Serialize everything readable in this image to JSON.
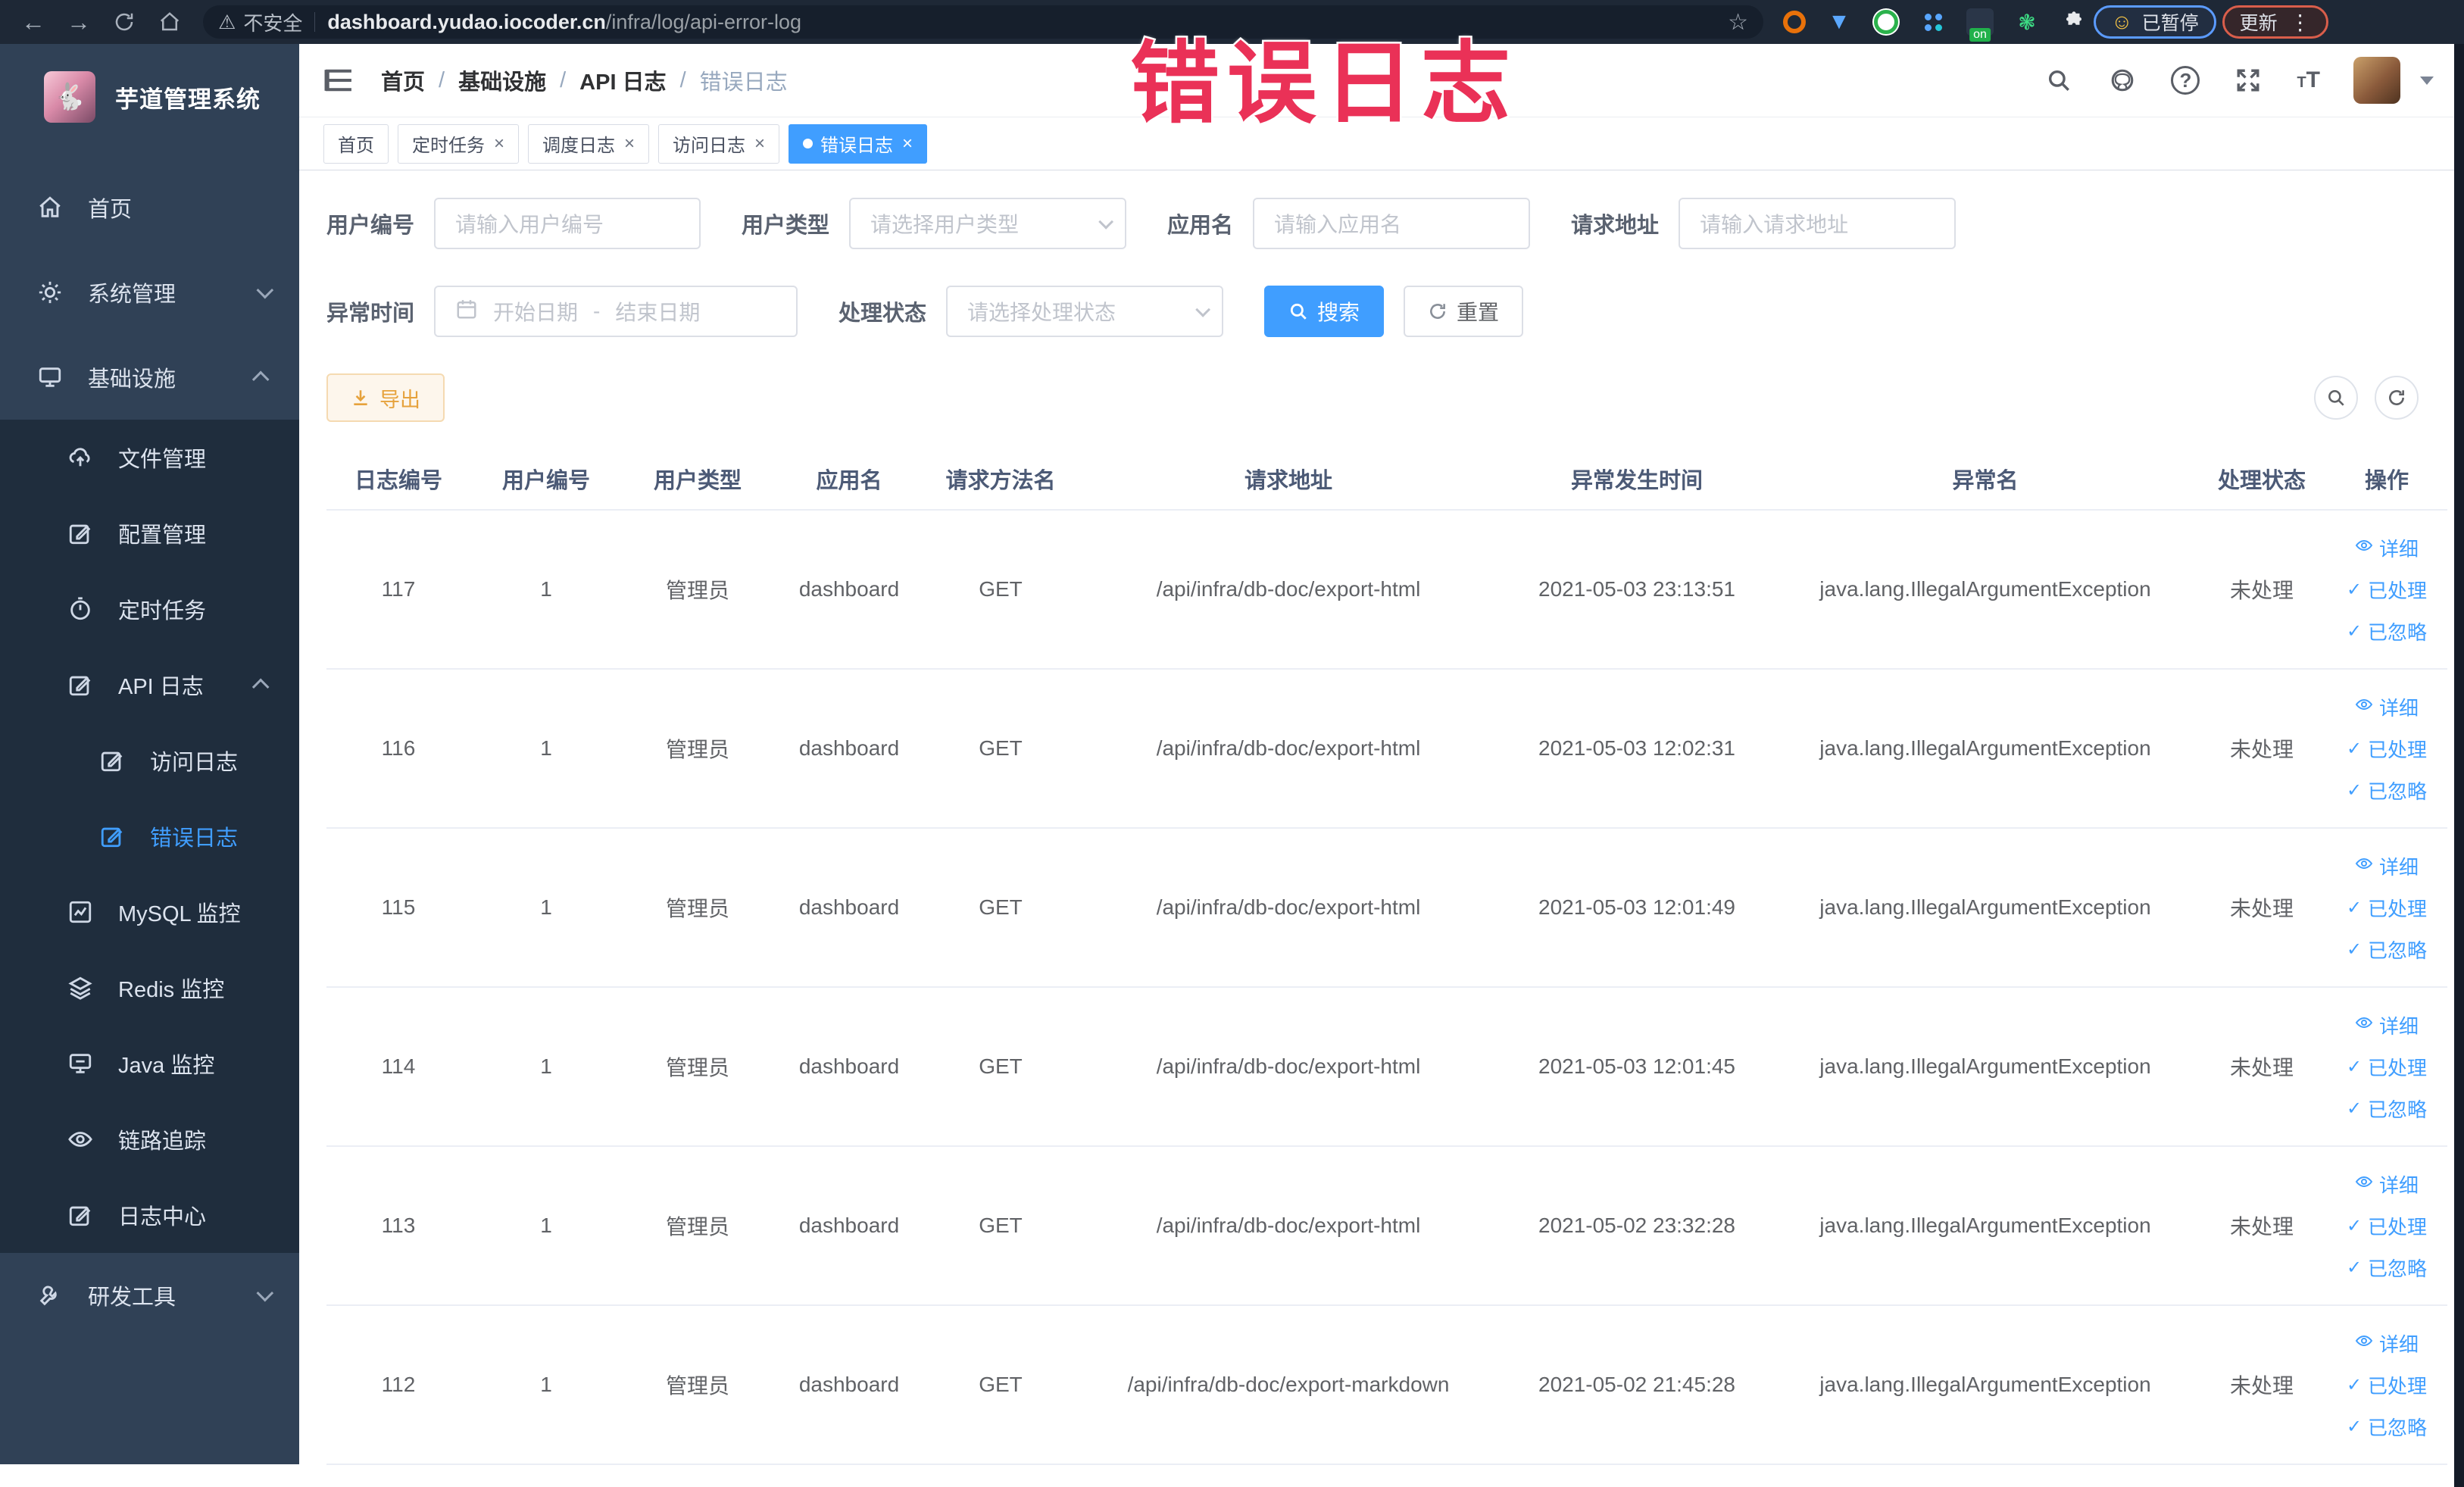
{
  "annotation": {
    "text": "错误日志"
  },
  "browser": {
    "nav_icons": [
      "back-arrow",
      "forward-arrow",
      "reload",
      "home"
    ],
    "security_label": "不安全",
    "url_host": "dashboard.yudao.iocoder.cn",
    "url_path": "/infra/log/api-error-log",
    "bookmark_icon": "star",
    "extensions": [
      "orange-ring-extension",
      "blue-drop-extension",
      "green-disc-extension",
      "dot-grid-extension",
      "adblock-on-extension",
      "green-leaf-extension",
      "puzzle-extensions-menu"
    ],
    "adblock_badge": "on",
    "paused_pill": {
      "emoji": "☺",
      "label": "已暂停"
    },
    "update_pill": {
      "label": "更新",
      "menu_icon": "kebab-menu"
    }
  },
  "sidebar": {
    "app_title": "芋道管理系统",
    "items": [
      {
        "label": "首页",
        "icon": "home-icon",
        "depth": 0
      },
      {
        "label": "系统管理",
        "icon": "gear-icon",
        "depth": 0,
        "chevron": "down"
      },
      {
        "label": "基础设施",
        "icon": "monitor-icon",
        "depth": 0,
        "chevron": "up"
      },
      {
        "label": "文件管理",
        "icon": "cloud-upload-icon",
        "depth": 1
      },
      {
        "label": "配置管理",
        "icon": "edit-icon",
        "depth": 1
      },
      {
        "label": "定时任务",
        "icon": "timer-icon",
        "depth": 1
      },
      {
        "label": "API 日志",
        "icon": "log-icon",
        "depth": 1,
        "chevron": "up"
      },
      {
        "label": "访问日志",
        "icon": "log-icon",
        "depth": 2
      },
      {
        "label": "错误日志",
        "icon": "log-icon",
        "depth": 2,
        "active": true
      },
      {
        "label": "MySQL 监控",
        "icon": "chart-icon",
        "depth": 1
      },
      {
        "label": "Redis 监控",
        "icon": "layers-icon",
        "depth": 1
      },
      {
        "label": "Java 监控",
        "icon": "screen-icon",
        "depth": 1
      },
      {
        "label": "链路追踪",
        "icon": "eye-icon",
        "depth": 1
      },
      {
        "label": "日志中心",
        "icon": "log-icon",
        "depth": 1
      },
      {
        "label": "研发工具",
        "icon": "tool-icon",
        "depth": 0,
        "chevron": "down"
      }
    ]
  },
  "header": {
    "breadcrumb": [
      "首页",
      "基础设施",
      "API 日志",
      "错误日志"
    ],
    "right_icons": [
      "search-icon",
      "github-icon",
      "help-icon",
      "fullscreen-icon",
      "font-size-icon",
      "avatar",
      "caret-down-icon"
    ]
  },
  "tabs": [
    {
      "label": "首页",
      "closable": false,
      "active": false
    },
    {
      "label": "定时任务",
      "closable": true,
      "active": false
    },
    {
      "label": "调度日志",
      "closable": true,
      "active": false
    },
    {
      "label": "访问日志",
      "closable": true,
      "active": false
    },
    {
      "label": "错误日志",
      "closable": true,
      "active": true
    }
  ],
  "filters": {
    "row1": [
      {
        "label": "用户编号",
        "placeholder": "请输入用户编号",
        "type": "input"
      },
      {
        "label": "用户类型",
        "placeholder": "请选择用户类型",
        "type": "select"
      },
      {
        "label": "应用名",
        "placeholder": "请输入应用名",
        "type": "input"
      },
      {
        "label": "请求地址",
        "placeholder": "请输入请求地址",
        "type": "input"
      }
    ],
    "date_filter": {
      "label": "异常时间",
      "start_placeholder": "开始日期",
      "separator": "-",
      "end_placeholder": "结束日期"
    },
    "status_filter": {
      "label": "处理状态",
      "placeholder": "请选择处理状态"
    },
    "search_label": "搜索",
    "reset_label": "重置"
  },
  "toolbar": {
    "export_label": "导出",
    "corner_icons": [
      "search-toggle-icon",
      "refresh-icon"
    ]
  },
  "table": {
    "columns": [
      "日志编号",
      "用户编号",
      "用户类型",
      "应用名",
      "请求方法名",
      "请求地址",
      "异常发生时间",
      "异常名",
      "处理状态",
      "操作"
    ],
    "rows": [
      [
        "117",
        "1",
        "管理员",
        "dashboard",
        "GET",
        "/api/infra/db-doc/export-html",
        "2021-05-03 23:13:51",
        "java.lang.IllegalArgumentException",
        "未处理"
      ],
      [
        "116",
        "1",
        "管理员",
        "dashboard",
        "GET",
        "/api/infra/db-doc/export-html",
        "2021-05-03 12:02:31",
        "java.lang.IllegalArgumentException",
        "未处理"
      ],
      [
        "115",
        "1",
        "管理员",
        "dashboard",
        "GET",
        "/api/infra/db-doc/export-html",
        "2021-05-03 12:01:49",
        "java.lang.IllegalArgumentException",
        "未处理"
      ],
      [
        "114",
        "1",
        "管理员",
        "dashboard",
        "GET",
        "/api/infra/db-doc/export-html",
        "2021-05-03 12:01:45",
        "java.lang.IllegalArgumentException",
        "未处理"
      ],
      [
        "113",
        "1",
        "管理员",
        "dashboard",
        "GET",
        "/api/infra/db-doc/export-html",
        "2021-05-02 23:32:28",
        "java.lang.IllegalArgumentException",
        "未处理"
      ],
      [
        "112",
        "1",
        "管理员",
        "dashboard",
        "GET",
        "/api/infra/db-doc/export-markdown",
        "2021-05-02 21:45:28",
        "java.lang.IllegalArgumentException",
        "未处理"
      ]
    ],
    "row_actions": [
      {
        "label": "详细",
        "icon": "view-icon"
      },
      {
        "label": "已处理",
        "icon": "check-icon"
      },
      {
        "label": "已忽略",
        "icon": "check-icon"
      }
    ]
  },
  "colors": {
    "accent": "#409EFF",
    "warning": "#e6a23c",
    "sidebar_bg": "#304156",
    "submenu_bg": "#1f2d3d",
    "annotation_red": "#ea3157",
    "chrome_bg": "#1e2836"
  }
}
